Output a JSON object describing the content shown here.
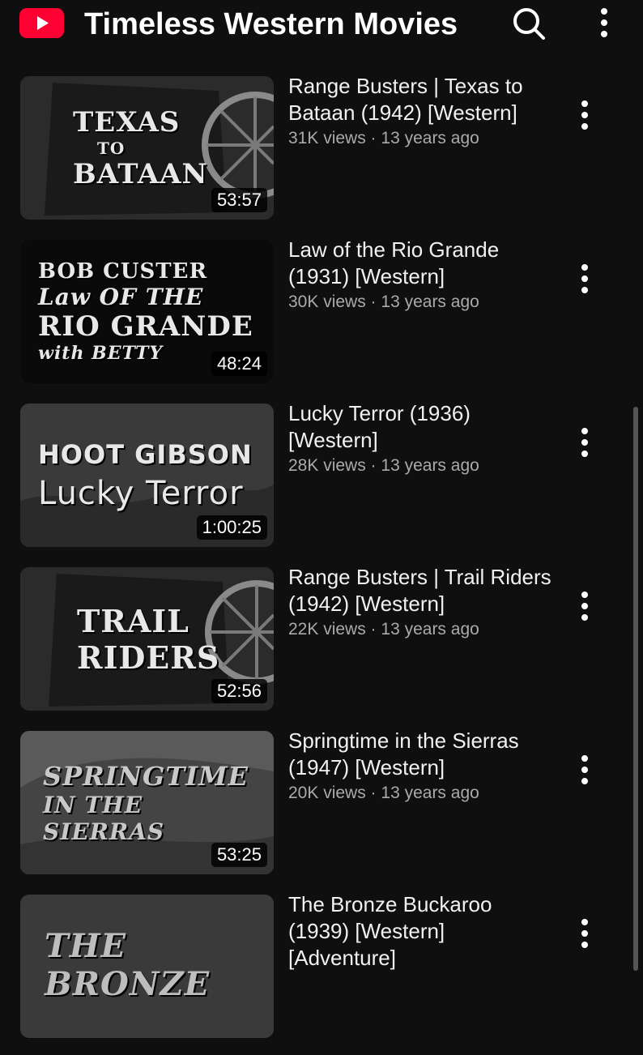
{
  "header": {
    "channel_title": "Timeless Western Movies",
    "icons": {
      "logo": "youtube-logo",
      "search": "search-icon",
      "menu": "more-vert-icon"
    }
  },
  "videos": [
    {
      "title": "Range Busters | Texas to Bataan (1942) [Western]",
      "views": "31K views",
      "age": "13 years ago",
      "duration": "53:57",
      "thumb_text": [
        "TEXAS",
        "TO",
        "BATAAN"
      ]
    },
    {
      "title": "Law of the Rio Grande (1931) [Western]",
      "views": "30K views",
      "age": "13 years ago",
      "duration": "48:24",
      "thumb_text": [
        "BOB CUSTER",
        "Law OF THE",
        "RIO GRANDE",
        "with BETTY"
      ]
    },
    {
      "title": "Lucky Terror (1936) [Western]",
      "views": "28K views",
      "age": "13 years ago",
      "duration": "1:00:25",
      "thumb_text": [
        "HOOT GIBSON",
        "Lucky Terror"
      ]
    },
    {
      "title": "Range Busters | Trail Riders (1942) [Western]",
      "views": "22K views",
      "age": "13 years ago",
      "duration": "52:56",
      "thumb_text": [
        "TRAIL",
        "RIDERS"
      ]
    },
    {
      "title": "Springtime in the Sierras (1947) [Western]",
      "views": "20K views",
      "age": "13 years ago",
      "duration": "53:25",
      "thumb_text": [
        "SPRINGTIME",
        "IN THE SIERRAS"
      ]
    },
    {
      "title": "The Bronze Buckaroo (1939) [Western] [Adventure]",
      "views": "",
      "age": "",
      "duration": "",
      "thumb_text": [
        "THE BRONZE"
      ]
    }
  ],
  "colors": {
    "background": "#0f0f0f",
    "logo_red": "#ff0033",
    "meta_gray": "#aaaaaa"
  }
}
